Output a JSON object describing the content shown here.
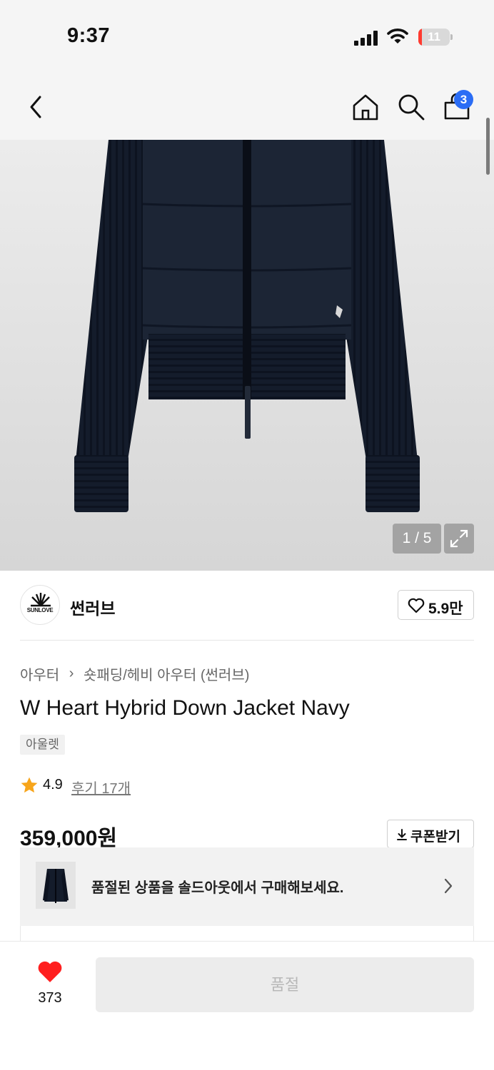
{
  "status_bar": {
    "time": "9:37",
    "battery": "11",
    "battery_level": 0.11
  },
  "nav": {
    "back_icon": "chevron-left-icon",
    "home_icon": "home-icon",
    "search_icon": "search-icon",
    "cart_icon": "shopping-bag-icon",
    "cart_count": "3"
  },
  "gallery": {
    "counter": "1 / 5",
    "expand_icon": "expand-icon"
  },
  "brand": {
    "name": "썬러브",
    "logo_text": "SUNLOVE",
    "likes": "5.9만"
  },
  "breadcrumb": {
    "level1": "아우터",
    "level2": "숏패딩/헤비 아우터 (썬러브)"
  },
  "product": {
    "title": "W Heart Hybrid Down Jacket Navy",
    "tag": "아울렛",
    "rating": "4.9",
    "reviews": "후기 17개",
    "price": "359,000원"
  },
  "coupon": {
    "label": "쿠폰받기",
    "icon": "download-icon"
  },
  "soldout_banner": {
    "text": "품절된 상품을 솔드아웃에서 구매해보세요."
  },
  "bottom_bar": {
    "wish_count": "373",
    "buy_label": "품절"
  },
  "colors": {
    "accent_blue": "#2b6df5",
    "wish_red": "#ff1f1f",
    "star": "#f7a51b",
    "jacket_navy": "#141c2b"
  }
}
